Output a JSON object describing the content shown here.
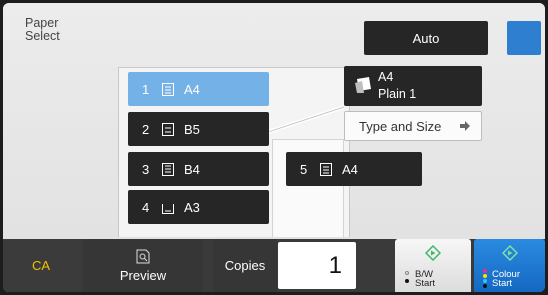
{
  "header": {
    "title": "Paper\nSelect",
    "auto_label": "Auto"
  },
  "trays": [
    {
      "number": "1",
      "size": "A4",
      "selected": true
    },
    {
      "number": "2",
      "size": "B5",
      "selected": false
    },
    {
      "number": "3",
      "size": "B4",
      "selected": false
    },
    {
      "number": "4",
      "size": "A3",
      "selected": false
    },
    {
      "number": "5",
      "size": "A4",
      "selected": false
    }
  ],
  "info": {
    "size": "A4",
    "type": "Plain 1",
    "type_size_button": "Type and Size"
  },
  "bottom": {
    "ca_label": "CA",
    "preview_label": "Preview",
    "copies_label": "Copies",
    "copies_value": "1",
    "bw_line1": "B/W",
    "bw_line2": "Start",
    "colour_line1": "Colour",
    "colour_line2": "Start"
  },
  "colors": {
    "accent_blue": "#2f7fd1",
    "selected_tray": "#74b1e6",
    "ca_yellow": "#f2c200",
    "start_green": "#3fb96a"
  }
}
